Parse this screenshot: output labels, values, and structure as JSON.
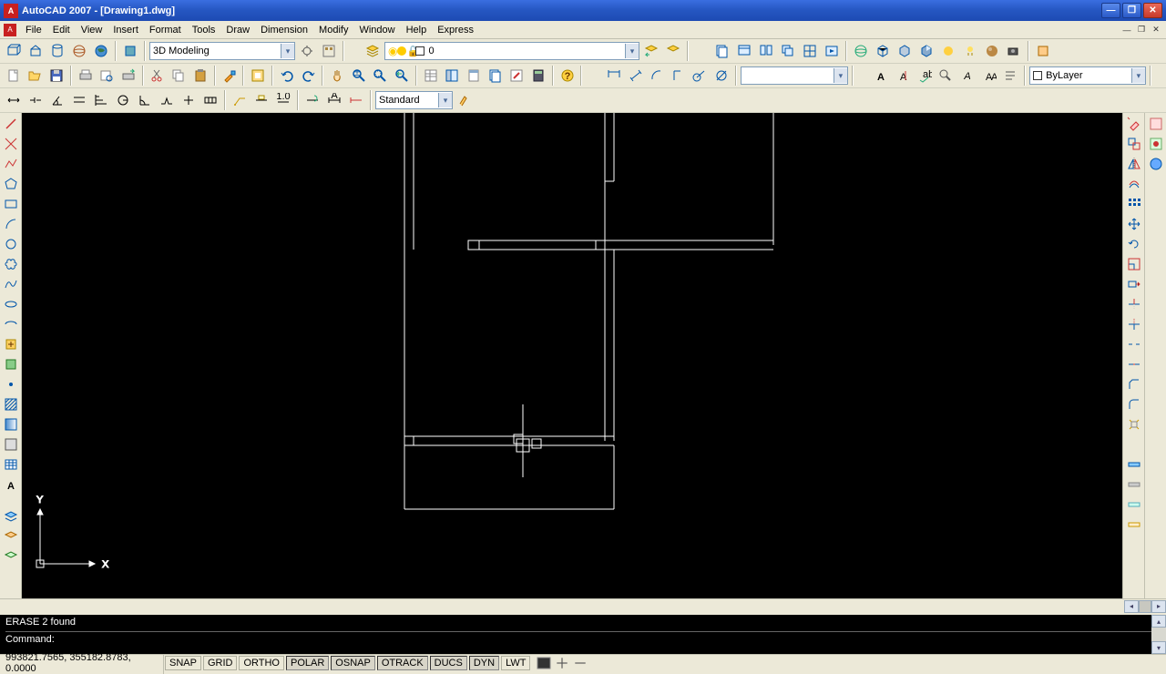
{
  "title": "AutoCAD 2007 - [Drawing1.dwg]",
  "menu": [
    "File",
    "Edit",
    "View",
    "Insert",
    "Format",
    "Tools",
    "Draw",
    "Dimension",
    "Modify",
    "Window",
    "Help",
    "Express"
  ],
  "workspace_combo": "3D Modeling",
  "layer_display": "0",
  "color_combo": "ByLayer",
  "textstyle_combo": "Standard",
  "command_history": "ERASE 2 found",
  "command_prompt": "Command:",
  "statusbar": {
    "coords": "993821.7565, 355182.8783, 0.0000",
    "toggles": [
      {
        "label": "SNAP",
        "on": false
      },
      {
        "label": "GRID",
        "on": false
      },
      {
        "label": "ORTHO",
        "on": false
      },
      {
        "label": "POLAR",
        "on": true
      },
      {
        "label": "OSNAP",
        "on": true
      },
      {
        "label": "OTRACK",
        "on": true
      },
      {
        "label": "DUCS",
        "on": true
      },
      {
        "label": "DYN",
        "on": true
      },
      {
        "label": "LWT",
        "on": false
      }
    ]
  },
  "ucs": {
    "x": "X",
    "y": "Y"
  }
}
